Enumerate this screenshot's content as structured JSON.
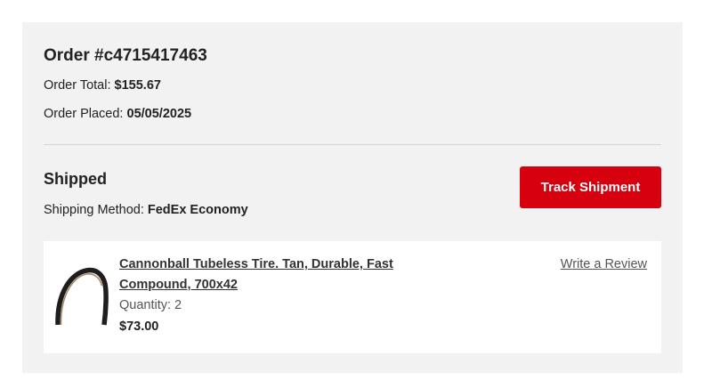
{
  "order": {
    "number": "Order #c4715417463",
    "total_label": "Order Total:",
    "total_value": "$155.67",
    "placed_label": "Order Placed:",
    "placed_value": "05/05/2025"
  },
  "shipment": {
    "status": "Shipped",
    "method_label": "Shipping Method:",
    "method_value": "FedEx Economy",
    "track_button_label": "Track Shipment"
  },
  "items": [
    {
      "name": "Cannonball Tubeless Tire. Tan, Durable, Fast Compound, 700x42",
      "quantity": "Quantity: 2",
      "price": "$73.00",
      "review_link": "Write a Review",
      "image_icon": "tire-image"
    }
  ],
  "colors": {
    "accent": "#d7000f",
    "card_background": "#f2f2f2",
    "item_background": "#ffffff"
  }
}
